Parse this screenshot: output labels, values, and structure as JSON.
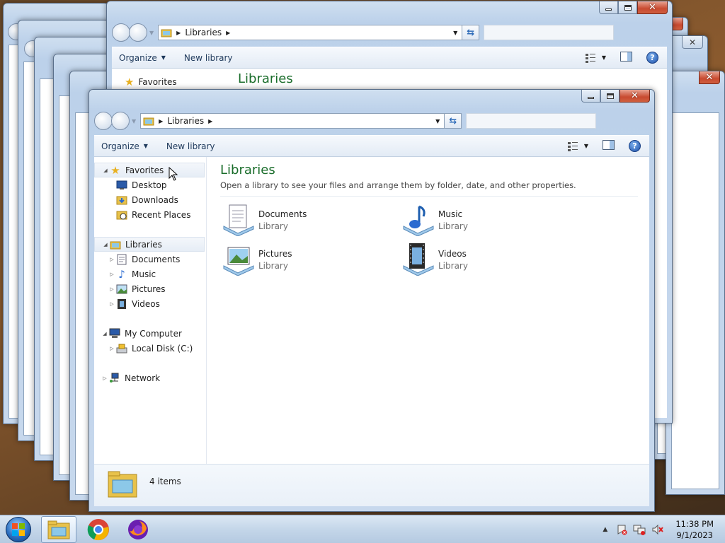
{
  "window": {
    "title": "Libraries",
    "breadcrumb": [
      "Libraries"
    ],
    "search_placeholder": ""
  },
  "toolbar": {
    "organize_label": "Organize",
    "new_library_label": "New library"
  },
  "nav_tree": {
    "favorites": {
      "label": "Favorites",
      "items": [
        "Desktop",
        "Downloads",
        "Recent Places"
      ]
    },
    "libraries": {
      "label": "Libraries",
      "items": [
        "Documents",
        "Music",
        "Pictures",
        "Videos"
      ]
    },
    "computer": {
      "label": "My Computer",
      "items": [
        "Local Disk (C:)"
      ]
    },
    "network": {
      "label": "Network"
    }
  },
  "content": {
    "heading": "Libraries",
    "subheading": "Open a library to see your files and arrange them by folder, date, and other properties.",
    "libraries": [
      {
        "name": "Documents",
        "kind": "Library",
        "icon": "documents-library-icon"
      },
      {
        "name": "Music",
        "kind": "Library",
        "icon": "music-library-icon"
      },
      {
        "name": "Pictures",
        "kind": "Library",
        "icon": "pictures-library-icon"
      },
      {
        "name": "Videos",
        "kind": "Library",
        "icon": "videos-library-icon"
      }
    ]
  },
  "details": {
    "item_count": "4 items"
  },
  "taskbar": {
    "pinned": [
      "windows-explorer-icon",
      "chrome-icon",
      "firefox-icon"
    ],
    "clock_time": "11:38 PM",
    "clock_date": "9/1/2023"
  },
  "colors": {
    "heading_green": "#1a6d2b",
    "link_blue": "#1e395b",
    "close_red": "#c84a30"
  }
}
